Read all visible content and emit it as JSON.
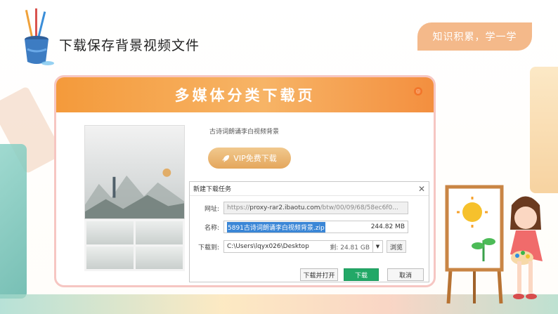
{
  "header": {
    "title": "下载保存背景视频文件",
    "badge": "知识积累，学一学"
  },
  "banner": {
    "title": "多媒体分类下载页",
    "close_glyph": "◎"
  },
  "resource": {
    "title": "古诗词朗诵李白视频背景",
    "vip_button": "VIP免费下载",
    "vip_icon": "rocket-icon"
  },
  "dialog": {
    "title": "新建下载任务",
    "close_glyph": "✕",
    "url_label": "网址:",
    "url_prefix": "https://",
    "url_host": "proxy-rar2.ibaotu.com",
    "url_path": "/btw/00/09/68/58ec6f0...",
    "name_label": "名称:",
    "name_value": "5891古诗词朗诵李白视频背景.zip",
    "name_size": "244.82 MB",
    "path_label": "下载到:",
    "path_value": "C:\\Users\\lqyx026\\Desktop",
    "path_free": "剩: 24.81 GB",
    "dropdown_glyph": "▼",
    "browse_button": "浏览",
    "open_button": "下载并打开",
    "download_button": "下载",
    "cancel_button": "取消"
  },
  "colors": {
    "accent_orange": "#f49a3b",
    "badge": "#f4b98a",
    "frame_border": "#f6c6c2",
    "download_green": "#22a867",
    "selection_blue": "#3a86d6"
  }
}
